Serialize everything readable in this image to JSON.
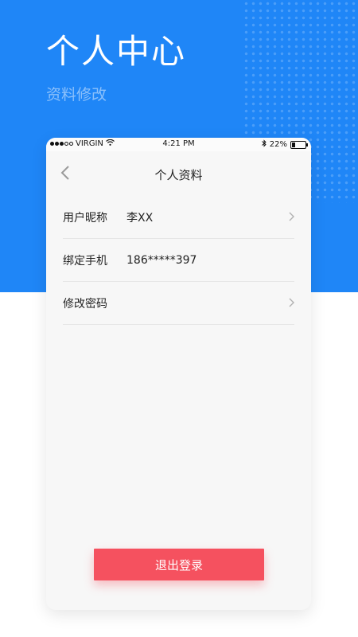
{
  "header": {
    "title": "个人中心",
    "subtitle": "资料修改"
  },
  "status_bar": {
    "carrier": "VIRGIN",
    "time": "4:21 PM",
    "battery": "22%",
    "battery_level": 0.22,
    "signal_dots_filled": 3,
    "signal_dots_total": 5
  },
  "nav": {
    "title": "个人资料",
    "back_icon": "chevron-left-icon"
  },
  "rows": [
    {
      "label": "用户昵称",
      "value": "李XX",
      "chevron": true
    },
    {
      "label": "绑定手机",
      "value": "186*****397",
      "chevron": false
    },
    {
      "label": "修改密码",
      "value": "",
      "chevron": true
    }
  ],
  "logout_label": "退出登录",
  "colors": {
    "brand_blue": "#1f86f7",
    "logout_red": "#f5515f"
  }
}
